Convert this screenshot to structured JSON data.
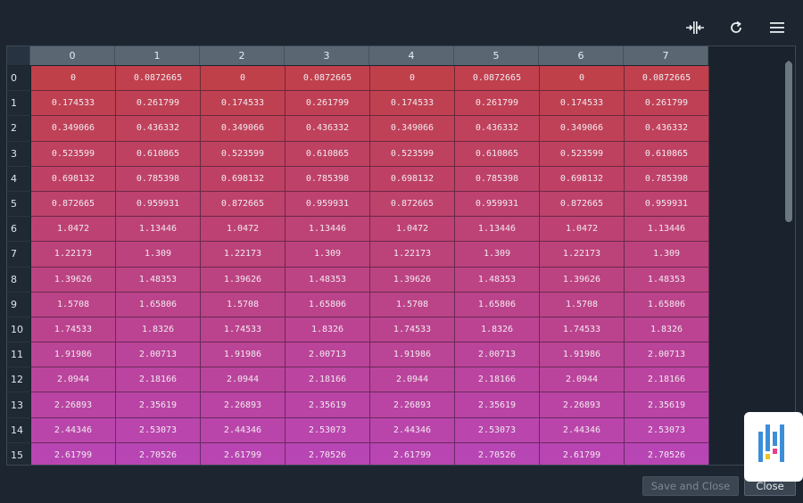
{
  "toolbar": {
    "icons": [
      "resize-columns-icon",
      "refresh-icon",
      "menu-icon"
    ]
  },
  "table": {
    "column_headers": [
      "0",
      "1",
      "2",
      "3",
      "4",
      "5",
      "6",
      "7"
    ],
    "row_headers": [
      "0",
      "1",
      "2",
      "3",
      "4",
      "5",
      "6",
      "7",
      "8",
      "9",
      "10",
      "11",
      "12",
      "13",
      "14",
      "15"
    ],
    "rows": [
      [
        "0",
        "0.0872665",
        "0",
        "0.0872665",
        "0",
        "0.0872665",
        "0",
        "0.0872665"
      ],
      [
        "0.174533",
        "0.261799",
        "0.174533",
        "0.261799",
        "0.174533",
        "0.261799",
        "0.174533",
        "0.261799"
      ],
      [
        "0.349066",
        "0.436332",
        "0.349066",
        "0.436332",
        "0.349066",
        "0.436332",
        "0.349066",
        "0.436332"
      ],
      [
        "0.523599",
        "0.610865",
        "0.523599",
        "0.610865",
        "0.523599",
        "0.610865",
        "0.523599",
        "0.610865"
      ],
      [
        "0.698132",
        "0.785398",
        "0.698132",
        "0.785398",
        "0.698132",
        "0.785398",
        "0.698132",
        "0.785398"
      ],
      [
        "0.872665",
        "0.959931",
        "0.872665",
        "0.959931",
        "0.872665",
        "0.959931",
        "0.872665",
        "0.959931"
      ],
      [
        "1.0472",
        "1.13446",
        "1.0472",
        "1.13446",
        "1.0472",
        "1.13446",
        "1.0472",
        "1.13446"
      ],
      [
        "1.22173",
        "1.309",
        "1.22173",
        "1.309",
        "1.22173",
        "1.309",
        "1.22173",
        "1.309"
      ],
      [
        "1.39626",
        "1.48353",
        "1.39626",
        "1.48353",
        "1.39626",
        "1.48353",
        "1.39626",
        "1.48353"
      ],
      [
        "1.5708",
        "1.65806",
        "1.5708",
        "1.65806",
        "1.5708",
        "1.65806",
        "1.5708",
        "1.65806"
      ],
      [
        "1.74533",
        "1.8326",
        "1.74533",
        "1.8326",
        "1.74533",
        "1.8326",
        "1.74533",
        "1.8326"
      ],
      [
        "1.91986",
        "2.00713",
        "1.91986",
        "2.00713",
        "1.91986",
        "2.00713",
        "1.91986",
        "2.00713"
      ],
      [
        "2.0944",
        "2.18166",
        "2.0944",
        "2.18166",
        "2.0944",
        "2.18166",
        "2.0944",
        "2.18166"
      ],
      [
        "2.26893",
        "2.35619",
        "2.26893",
        "2.35619",
        "2.26893",
        "2.35619",
        "2.26893",
        "2.35619"
      ],
      [
        "2.44346",
        "2.53073",
        "2.44346",
        "2.53073",
        "2.44346",
        "2.53073",
        "2.44346",
        "2.53073"
      ],
      [
        "2.61799",
        "2.70526",
        "2.61799",
        "2.70526",
        "2.61799",
        "2.70526",
        "2.61799",
        "2.70526"
      ]
    ],
    "color_scale": {
      "min_color": "#c0404a",
      "max_color": "#b845b4",
      "min_value": 0,
      "max_value": 2.70526
    }
  },
  "footer": {
    "save_close_label": "Save and Close",
    "close_label": "Close"
  },
  "colors": {
    "background": "#1c2530",
    "header": "#5a6773",
    "logo_blue": "#3d8ed8",
    "logo_yellow": "#f0c419",
    "logo_pink": "#e8408a"
  }
}
